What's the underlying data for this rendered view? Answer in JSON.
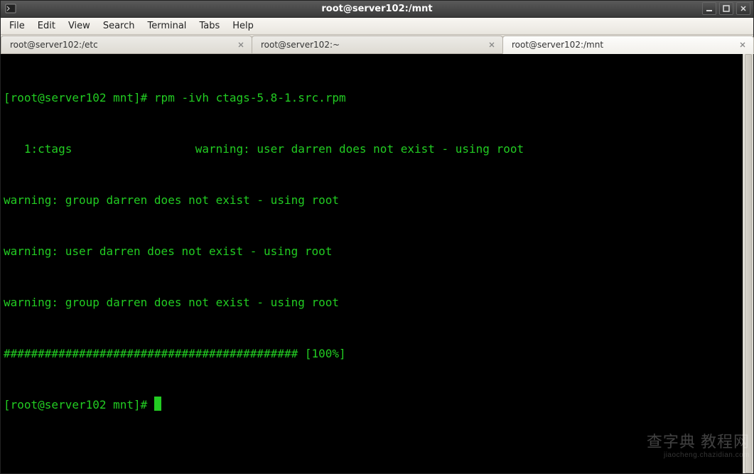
{
  "window": {
    "title": "root@server102:/mnt"
  },
  "menubar": {
    "items": [
      "File",
      "Edit",
      "View",
      "Search",
      "Terminal",
      "Tabs",
      "Help"
    ]
  },
  "tabs": [
    {
      "label": "root@server102:/etc",
      "active": false
    },
    {
      "label": "root@server102:~",
      "active": false
    },
    {
      "label": "root@server102:/mnt",
      "active": true
    }
  ],
  "terminal": {
    "lines": [
      "[root@server102 mnt]# rpm -ivh ctags-5.8-1.src.rpm",
      "   1:ctags                  warning: user darren does not exist - using root",
      "warning: group darren does not exist - using root",
      "warning: user darren does not exist - using root",
      "warning: group darren does not exist - using root",
      "########################################### [100%]",
      "[root@server102 mnt]# "
    ]
  },
  "watermark": {
    "main": "查字典 教程网",
    "sub": "jiaocheng.chazidian.com"
  }
}
